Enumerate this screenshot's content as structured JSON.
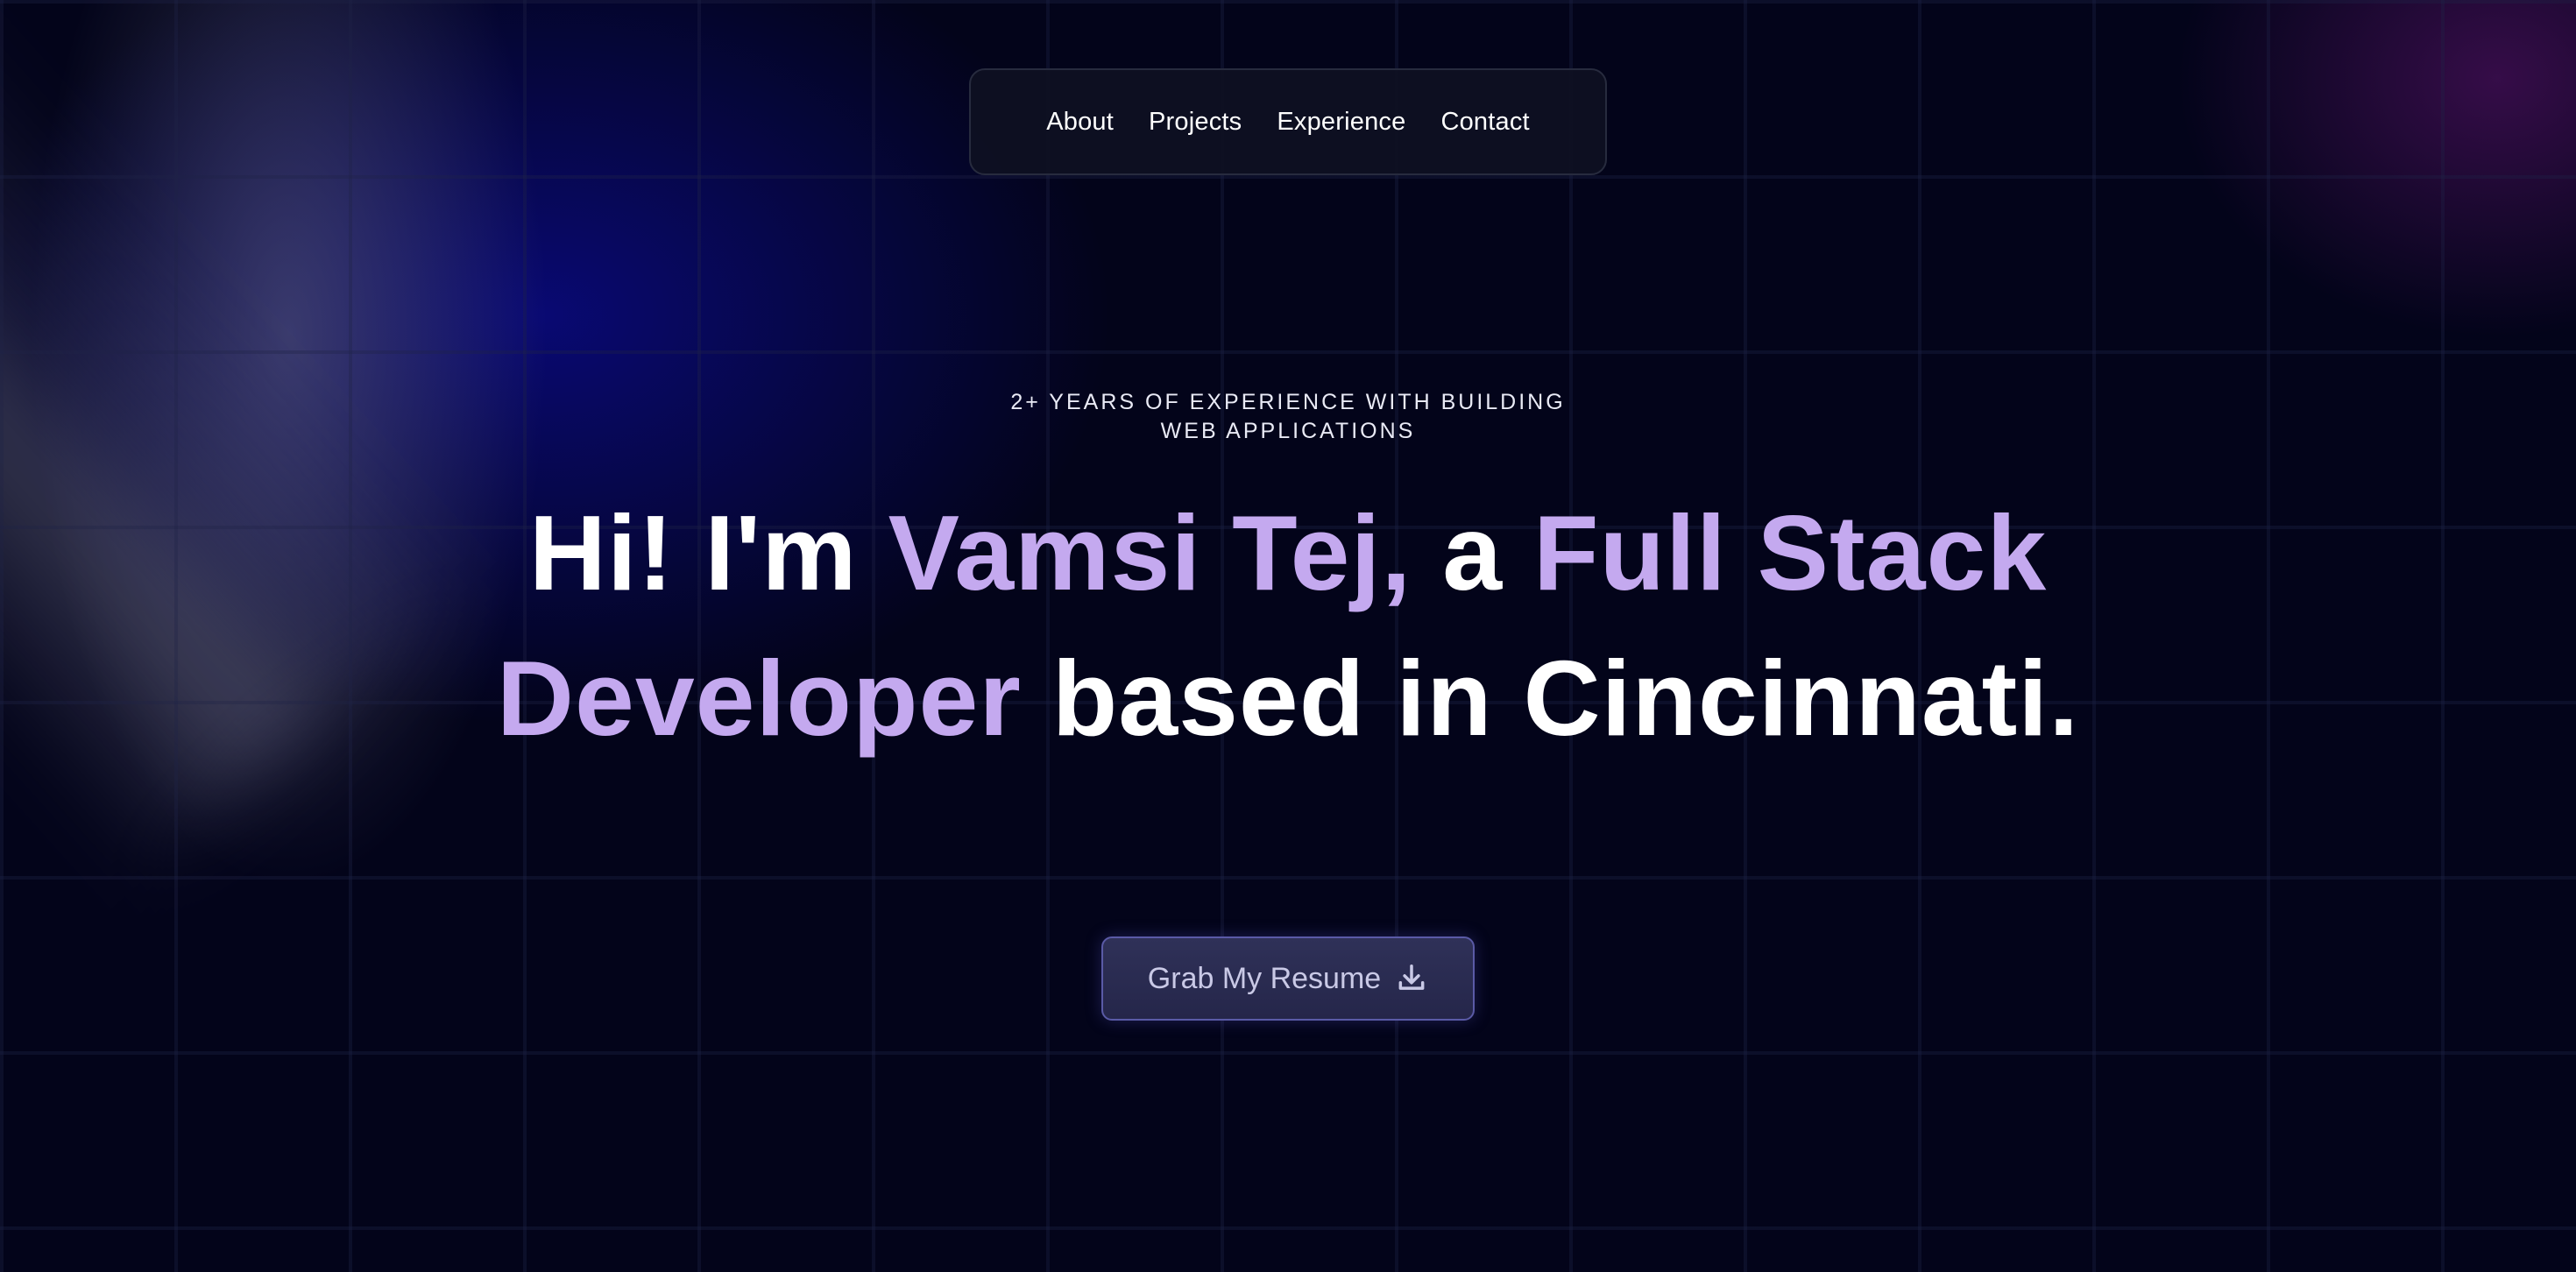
{
  "nav": {
    "items": [
      {
        "label": "About"
      },
      {
        "label": "Projects"
      },
      {
        "label": "Experience"
      },
      {
        "label": "Contact"
      }
    ]
  },
  "hero": {
    "eyebrow_line1": "2+ YEARS OF EXPERIENCE WITH BUILDING",
    "eyebrow_line2": "WEB APPLICATIONS",
    "headline": {
      "part1": "Hi! I'm ",
      "name": "Vamsi Tej,",
      "part2": " a ",
      "role": "Full Stack Developer",
      "part3": " based in Cincinnati."
    },
    "resume_button": {
      "label": "Grab My Resume",
      "icon": "download-icon"
    }
  },
  "colors": {
    "background": "#03041a",
    "accent": "#c4a9ef",
    "button_bg": "#2a2c52",
    "button_border": "#5a5aa6"
  }
}
